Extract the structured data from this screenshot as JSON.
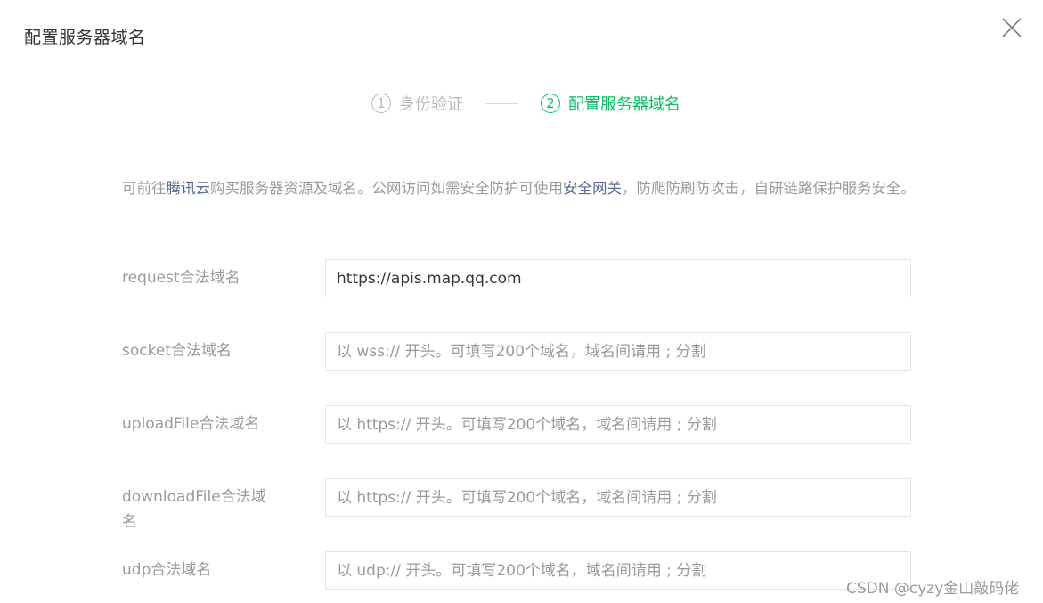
{
  "dialog": {
    "title": "配置服务器域名",
    "close_icon": "close-icon"
  },
  "steps": [
    {
      "num": "1",
      "label": "身份验证",
      "state": "done"
    },
    {
      "num": "2",
      "label": "配置服务器域名",
      "state": "active"
    }
  ],
  "notice": {
    "text_1": "可前往",
    "link_1": "腾讯云",
    "text_2": "购买服务器资源及域名。公网访问如需安全防护可使用",
    "link_2": "安全网关",
    "text_3": "，防爬防刷防攻击，自研链路保护服务安全。"
  },
  "form": {
    "request": {
      "label": "request合法域名",
      "value": "https://apis.map.qq.com",
      "placeholder": ""
    },
    "socket": {
      "label": "socket合法域名",
      "value": "",
      "placeholder": "以 wss:// 开头。可填写200个域名，域名间请用 ; 分割"
    },
    "upload": {
      "label": "uploadFile合法域名",
      "value": "",
      "placeholder": "以 https:// 开头。可填写200个域名，域名间请用 ; 分割"
    },
    "download": {
      "label": "downloadFile合法域名",
      "value": "",
      "placeholder": "以 https:// 开头。可填写200个域名，域名间请用 ; 分割"
    },
    "udp": {
      "label": "udp合法域名",
      "value": "",
      "placeholder": "以 udp:// 开头。可填写200个域名，域名间请用 ; 分割"
    }
  },
  "watermark": "CSDN @cyzy金山敲码佬",
  "colors": {
    "accent": "#07c160",
    "link": "#576b95",
    "muted": "#9a9a9a"
  }
}
